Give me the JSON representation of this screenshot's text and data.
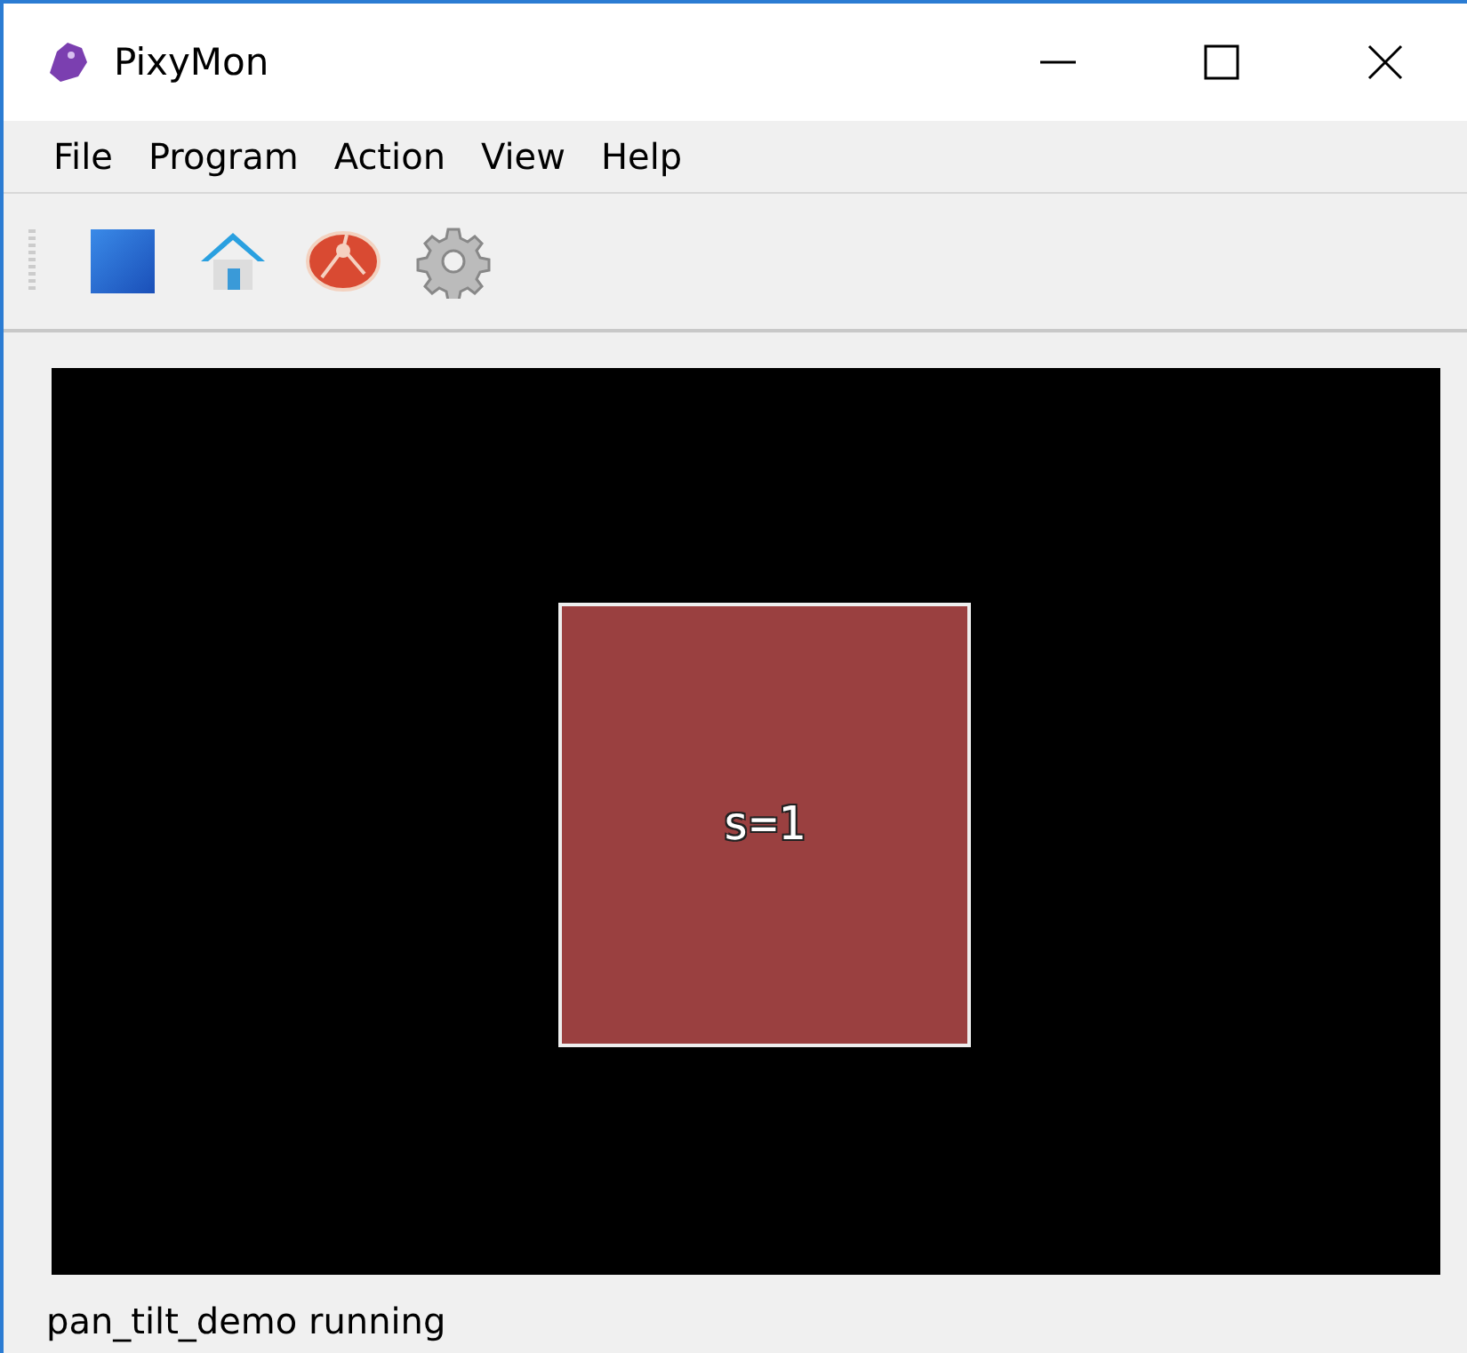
{
  "window": {
    "title": "PixyMon"
  },
  "menu": [
    "File",
    "Program",
    "Action",
    "View",
    "Help"
  ],
  "video": {
    "blocks": [
      {
        "label": "s=1",
        "color": "#9a4040"
      }
    ]
  },
  "status_bar": "pan_tilt_demo running"
}
